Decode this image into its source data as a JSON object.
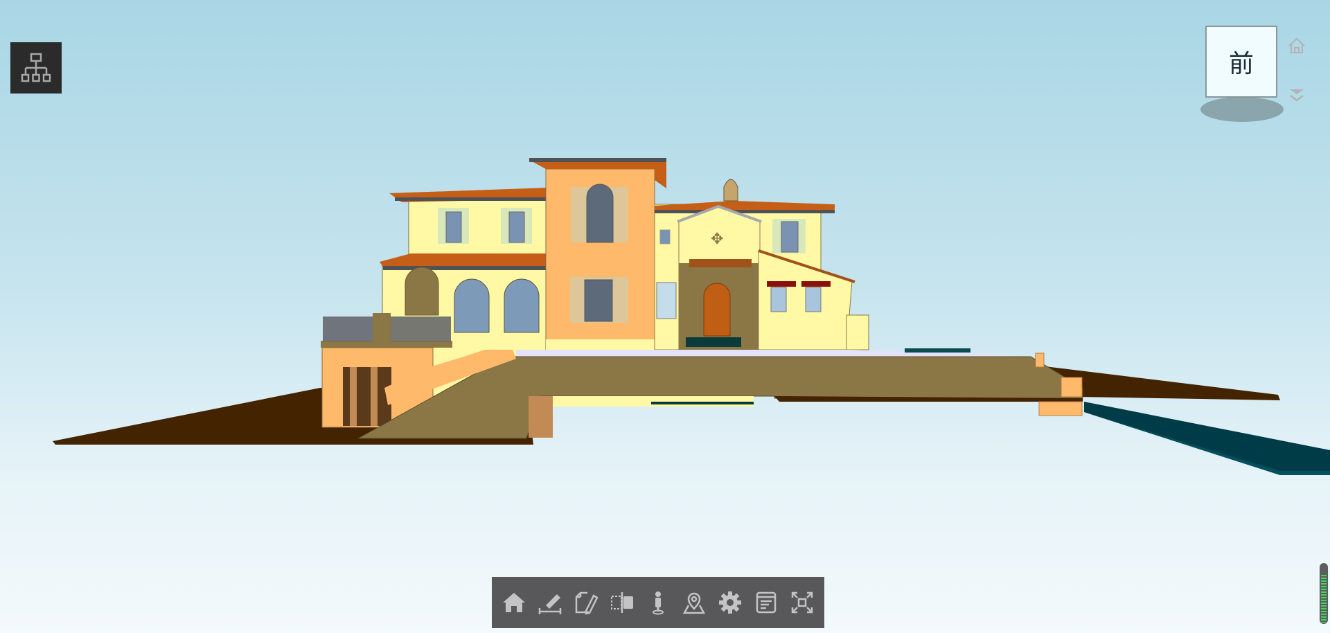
{
  "app": {
    "type": "BIM 3D model viewer"
  },
  "model_tree_button": {
    "icon": "hierarchy-tree-icon",
    "label": "Model tree"
  },
  "viewcube": {
    "face_label": "前",
    "home_icon": "home-icon",
    "menu_icon": "double-chevron-down-icon"
  },
  "toolbar": {
    "items": [
      {
        "id": "home",
        "icon": "home-icon",
        "label": "Home view"
      },
      {
        "id": "measure",
        "icon": "ruler-measure-icon",
        "label": "Measure"
      },
      {
        "id": "markup",
        "icon": "note-pencil-icon",
        "label": "Markup"
      },
      {
        "id": "section",
        "icon": "section-box-icon",
        "label": "Section"
      },
      {
        "id": "walk",
        "icon": "person-walk-icon",
        "label": "First person"
      },
      {
        "id": "location",
        "icon": "map-pin-icon",
        "label": "Location"
      },
      {
        "id": "settings",
        "icon": "gear-icon",
        "label": "Settings"
      },
      {
        "id": "properties",
        "icon": "document-list-icon",
        "label": "Properties"
      },
      {
        "id": "fullscreen",
        "icon": "fullscreen-icon",
        "label": "Full screen"
      }
    ]
  },
  "zoom_slider": {
    "level_fraction": 0.78
  },
  "colors": {
    "wall": "#fff9a5",
    "tower": "#ffb96b",
    "roof": "#c55f17",
    "ground_brown": "#432300",
    "ramp": "#8b7646",
    "water": "#003c47",
    "toolbar_bg": "#58585a",
    "icon_gray": "#c4c4c4"
  }
}
